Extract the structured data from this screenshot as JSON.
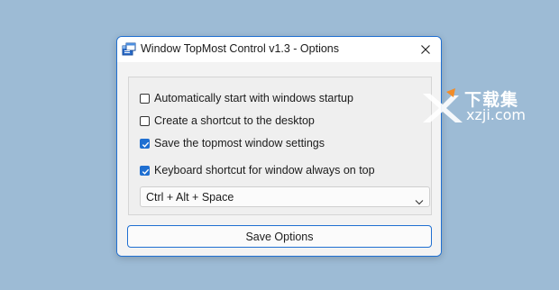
{
  "window": {
    "title": "Window TopMost Control v1.3 - Options",
    "accent_color": "#1f6fd1"
  },
  "options": [
    {
      "label": "Automatically start with windows startup",
      "checked": false
    },
    {
      "label": "Create a shortcut to the desktop",
      "checked": false
    },
    {
      "label": "Save the topmost window settings",
      "checked": true
    },
    {
      "label": "Keyboard shortcut for window always on top",
      "checked": true
    }
  ],
  "shortcut_select": {
    "value": "Ctrl + Alt + Space"
  },
  "save_button": {
    "label": "Save Options"
  },
  "watermark": {
    "text_cn": "下载集",
    "text_en": "xzji.com"
  },
  "icons": {
    "app": "app-window-icon",
    "close": "close-icon",
    "check": "checkmark-icon",
    "chevron": "chevron-down-icon"
  }
}
